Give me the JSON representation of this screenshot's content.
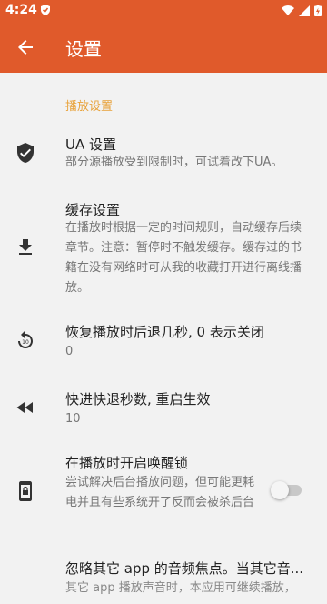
{
  "status_bar": {
    "time": "4:24",
    "icons": [
      "notification-shield-icon",
      "wifi-icon",
      "signal-icon",
      "battery-icon"
    ]
  },
  "app_bar": {
    "title": "设置",
    "back_icon": "arrow-back-icon",
    "color": "#e05a2b"
  },
  "section": {
    "header": "播放设置",
    "header_color": "#e8a23a"
  },
  "items": [
    {
      "icon": "shield-check-icon",
      "title": "UA 设置",
      "summary": "部分源播放受到限制时，可试着改下UA。"
    },
    {
      "icon": "download-icon",
      "title": "缓存设置",
      "summary": "在播放时根据一定的时间规则，自动缓存后续章节。注意：暂停时不触发缓存。缓存过的书籍在没有网络时可从我的收藏打开进行离线播放。"
    },
    {
      "icon": "replay-icon",
      "title": "恢复播放时后退几秒, 0 表示关闭",
      "summary": "0"
    },
    {
      "icon": "fast-rewind-icon",
      "title": "快进快退秒数, 重启生效",
      "summary": "10"
    },
    {
      "icon": "phone-lock-icon",
      "title": "在播放时开启唤醒锁",
      "summary": "尝试解决后台播放问题，但可能更耗电并且有些系统开了反而会被杀后台",
      "toggle": false
    },
    {
      "icon": "audio-focus-icon",
      "title": "忽略其它 app 的音频焦点。当其它音...",
      "summary": "其它 app 播放声音时，本应用可继续播放，"
    }
  ]
}
